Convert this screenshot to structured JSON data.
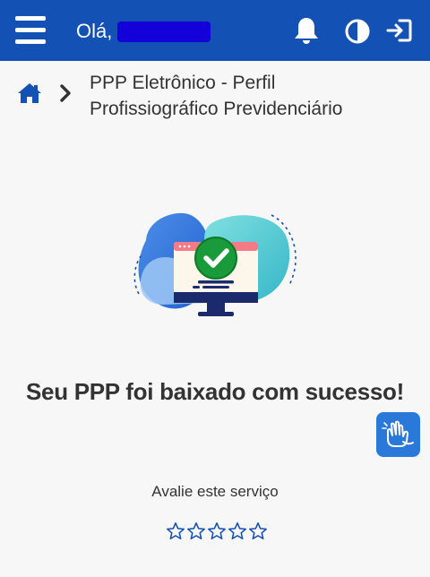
{
  "header": {
    "greeting": "Olá,",
    "icons": [
      "menu-icon",
      "bell-icon",
      "contrast-icon",
      "logout-icon"
    ],
    "background": "#1351b4"
  },
  "breadcrumb": {
    "home_icon": "home-icon",
    "separator_icon": "chevron-right-icon",
    "title_line1": "PPP Eletrônico - Perfil",
    "title_line2": "Profissiográfico Previdenciário"
  },
  "main": {
    "illustration": "computer-success-illustration",
    "success_message": "Seu PPP foi baixado com sucesso!"
  },
  "accessibility": {
    "icon": "sign-language-icon",
    "color": "#2a78d9"
  },
  "rating": {
    "label": "Avalie este serviço",
    "max_stars": 5,
    "selected": 0,
    "star_color": "#1351b4"
  }
}
